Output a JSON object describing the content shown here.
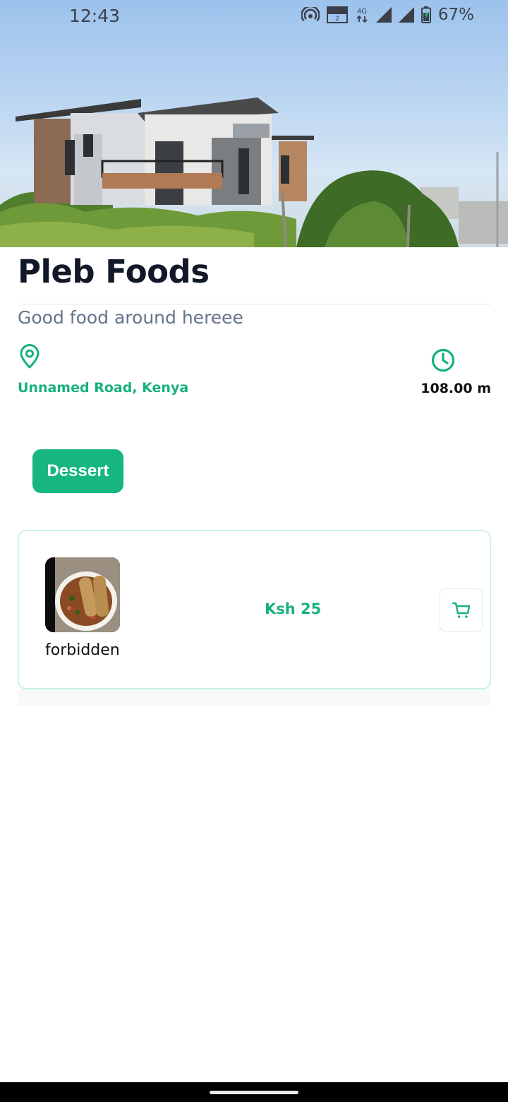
{
  "status_bar": {
    "time": "12:43",
    "network_label": "4G",
    "volte_label": "VoLTE",
    "battery_pct": "67%",
    "icons": [
      "hotspot-icon",
      "volte-icon",
      "network-4g-icon",
      "signal-icon",
      "signal-icon",
      "battery-icon"
    ]
  },
  "restaurant": {
    "name": "Pleb Foods",
    "tagline": "Good food around hereee",
    "location": "Unnamed Road, Kenya",
    "distance": "108.00 m",
    "icons": {
      "location": "location-pin-icon",
      "time": "clock-icon"
    }
  },
  "categories": [
    {
      "label": "Dessert",
      "selected": true
    }
  ],
  "menu_items": [
    {
      "name": "forbidden",
      "price": "Ksh 25",
      "action_icon": "cart-icon"
    }
  ],
  "colors": {
    "accent": "#16b27c",
    "chip": "#17b67e",
    "title": "#111827",
    "subtitle": "#64748b",
    "card_border": "#c9f2e3"
  }
}
